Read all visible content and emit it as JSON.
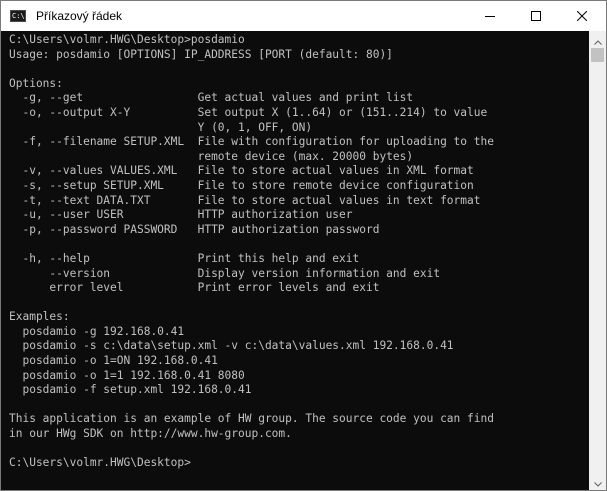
{
  "window": {
    "title": "Příkazový řádek",
    "icon_label": "C:\\"
  },
  "console": {
    "lines": [
      "C:\\Users\\volmr.HWG\\Desktop>posdamio",
      "Usage: posdamio [OPTIONS] IP_ADDRESS [PORT (default: 80)]",
      "",
      "Options:",
      "  -g, --get                 Get actual values and print list",
      "  -o, --output X-Y          Set output X (1..64) or (151..214) to value",
      "                            Y (0, 1, OFF, ON)",
      "  -f, --filename SETUP.XML  File with configuration for uploading to the",
      "                            remote device (max. 20000 bytes)",
      "  -v, --values VALUES.XML   File to store actual values in XML format",
      "  -s, --setup SETUP.XML     File to store remote device configuration",
      "  -t, --text DATA.TXT       File to store actual values in text format",
      "  -u, --user USER           HTTP authorization user",
      "  -p, --password PASSWORD   HTTP authorization password",
      "",
      "  -h, --help                Print this help and exit",
      "      --version             Display version information and exit",
      "      error level           Print error levels and exit",
      "",
      "Examples:",
      "  posdamio -g 192.168.0.41",
      "  posdamio -s c:\\data\\setup.xml -v c:\\data\\values.xml 192.168.0.41",
      "  posdamio -o 1=ON 192.168.0.41",
      "  posdamio -o 1=1 192.168.0.41 8080",
      "  posdamio -f setup.xml 192.168.0.41",
      "",
      "This application is an example of HW group. The source code you can find",
      "in our HWg SDK on http://www.hw-group.com.",
      "",
      "C:\\Users\\volmr.HWG\\Desktop>"
    ]
  },
  "icons": {
    "minimize": "minimize-icon",
    "maximize": "maximize-icon",
    "close": "close-icon",
    "scroll_up": "chevron-up-icon",
    "scroll_down": "chevron-down-icon"
  },
  "colors": {
    "console_bg": "#0c0c0c",
    "console_text": "#c0c0c0",
    "titlebar_bg": "#ffffff",
    "scrollbar_bg": "#f0f0f0"
  }
}
